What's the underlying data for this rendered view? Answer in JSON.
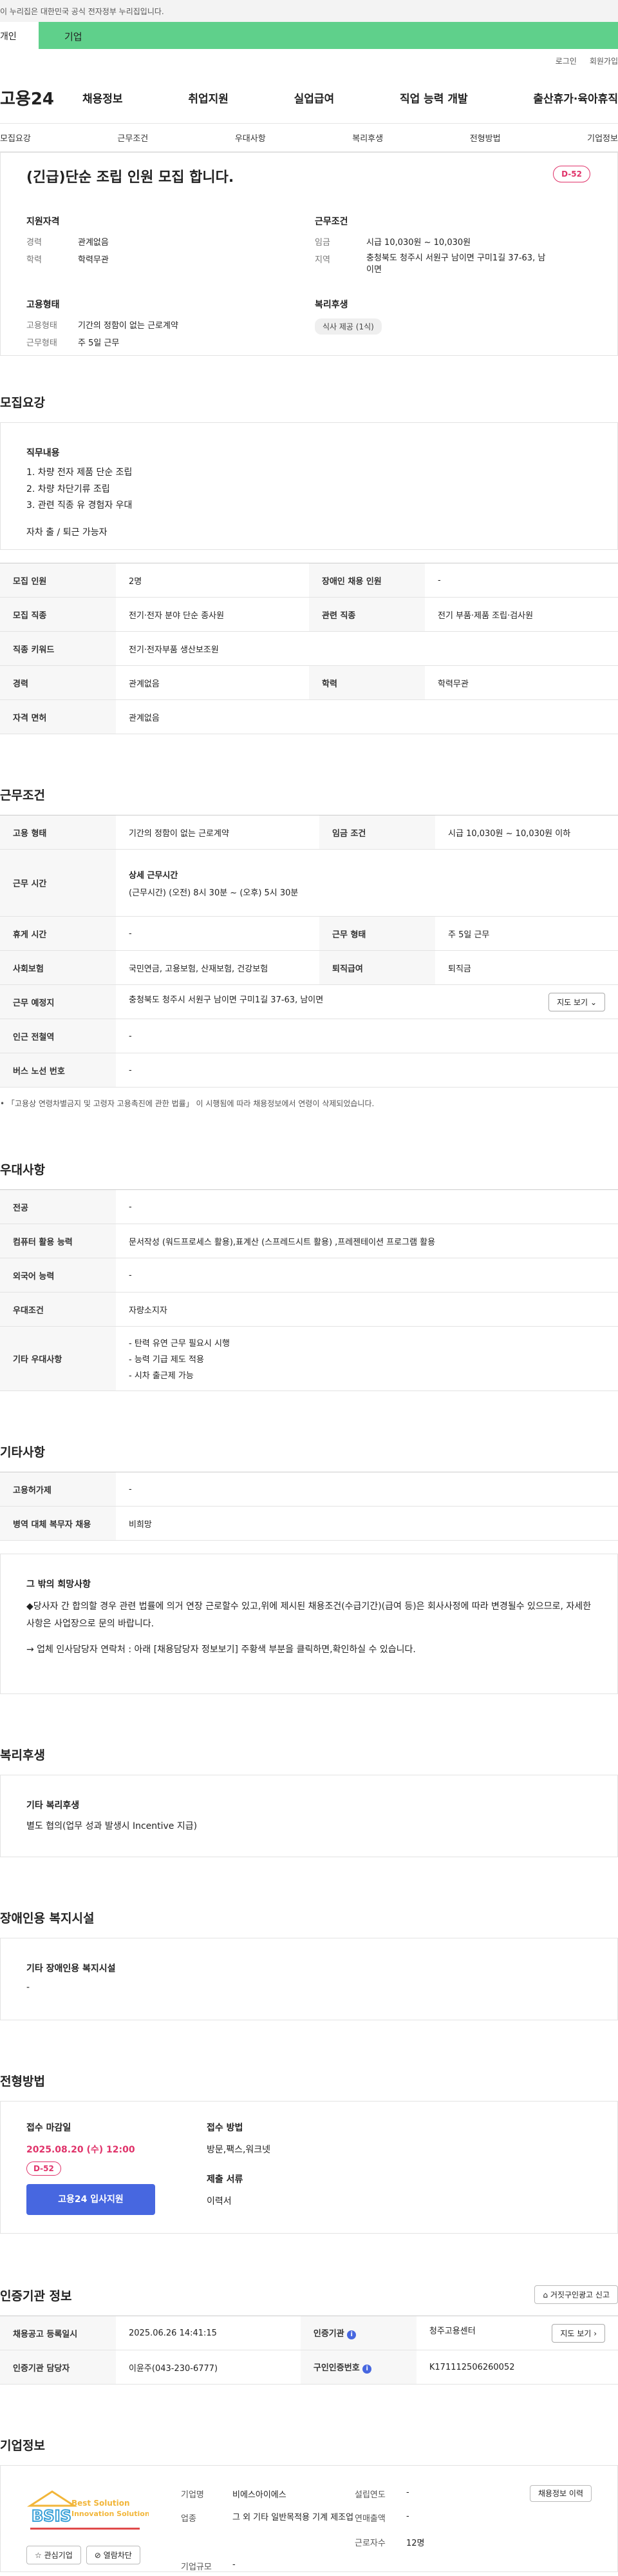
{
  "topbar": {
    "notice": "이 누리집은 대한민국 공식 전자정부 누리집입니다."
  },
  "typebar": {
    "personal": "개인",
    "company": "기업"
  },
  "util": {
    "login": "로그인",
    "join": "회원가입"
  },
  "gnb": {
    "logo": "고용24",
    "menu": [
      "채용정보",
      "취업지원",
      "실업급여",
      "직업 능력 개발",
      "출산휴가·육아휴직"
    ]
  },
  "subnav": [
    "모집요강",
    "근무조건",
    "우대사항",
    "복리후생",
    "전형방법",
    "기업정보"
  ],
  "summary": {
    "title": "(긴급)단순 조립 인원 모집 합니다.",
    "dday": "D-52",
    "qual_h": "지원자격",
    "career_k": "경력",
    "career_v": "관계없음",
    "edu_k": "학력",
    "edu_v": "학력무관",
    "work_h": "근무조건",
    "wage_k": "임금",
    "wage_v": "시급 10,030원 ~ 10,030원",
    "region_k": "지역",
    "region_v": "충청북도 청주시 서원구 남이면 구미1길 37-63, 남이면",
    "emp_h": "고용형태",
    "emptype_k": "고용형태",
    "emptype_v": "기간의 정함이 없는 근로계약",
    "workform_k": "근무형태",
    "workform_v": "주 5일 근무",
    "welfare_h": "복리후생",
    "welfare_tag": "식사 제공 (1식)"
  },
  "recruit": {
    "title": "모집요강",
    "job_h": "직무내용",
    "job_lines": [
      "1. 차량 전자 제품 단순 조립",
      "2. 차량 차단기류 조립",
      "3. 관련 직종 유 경험자 우대",
      "",
      "자차 출 / 퇴근 가능자"
    ],
    "rows": [
      [
        "모집 인원",
        "2명",
        "장애인 채용 인원",
        "-"
      ],
      [
        "모집 직종",
        "전기·전자 분야 단순 종사원",
        "관련 직종",
        "전기 부품·제품 조립·검사원"
      ],
      [
        "직종 키워드",
        "전기·전자부품 생산보조원"
      ],
      [
        "경력",
        "관계없음",
        "학력",
        "학력무관"
      ],
      [
        "자격 면허",
        "관계없음"
      ]
    ]
  },
  "work": {
    "title": "근무조건",
    "r1": [
      "고용 형태",
      "기간의 정함이 없는 근로계약",
      "임금 조건",
      "시급 10,030원 ~ 10,030원 이하"
    ],
    "time_k": "근무 시간",
    "time_h": "상세 근무시간",
    "time_v": "(근무시간) (오전) 8시 30분 ~ (오후) 5시 30분",
    "r3": [
      "휴게 시간",
      "-",
      "근무 형태",
      "주 5일 근무"
    ],
    "r4": [
      "사회보험",
      "국민연금, 고용보험, 산재보험, 건강보험",
      "퇴직급여",
      "퇴직금"
    ],
    "place_k": "근무 예정지",
    "place_v": "충청북도 청주시 서원구 남이면 구미1길 37-63, 남이면",
    "map_btn": "지도 보기",
    "r6": [
      "인근 전철역",
      "-"
    ],
    "r7": [
      "버스 노선 번호",
      "-"
    ],
    "note": "「고용상 연령차별금지 및 고령자 고용촉진에 관한 법률」 이 시행됨에 따라 채용정보에서 연령이 삭제되었습니다."
  },
  "pref": {
    "title": "우대사항",
    "r1": [
      "전공",
      "-"
    ],
    "r2": [
      "컴퓨터 활용 능력",
      "문서작성 (워드프로세스 활용),표계산 (스프레드시트 활용) ,프레젠테이션 프로그램 활용"
    ],
    "r3": [
      "외국어 능력",
      "-"
    ],
    "r4": [
      "우대조건",
      "자량소지자"
    ],
    "etc_k": "기타 우대사항",
    "etc_lines": [
      "- 탄력 유연 근무 필요시 시행",
      "- 능력 기급 제도 적용",
      "- 시차 출근제 가능"
    ]
  },
  "etc": {
    "title": "기타사항",
    "r1": [
      "고용허가제",
      "-"
    ],
    "r2": [
      "병역 대체 복무자 채용",
      "비희망"
    ],
    "box_h": "그 밖의 희망사항",
    "box_lines": [
      "◆당사자 간 합의할 경우 관련 법률에 의거 연장 근로할수 있고,위에 제시된 채용조건(수급기간)(급여 등)은 회사사정에 따라 변경될수 있으므로, 자세한 사항은 사업장으로 문의 바랍니다.",
      "",
      "→ 업체 인사담당자 연락처 : 아래 [채용담당자 정보보기] 주황색 부분을 클릭하면,확인하실 수 있습니다."
    ]
  },
  "welfare": {
    "title": "복리후생",
    "h": "기타 복리후생",
    "v": "별도 협의(업무 성과 발생시 Incentive 지급)"
  },
  "disabled": {
    "title": "장애인용 복지시설",
    "h": "기타 장애인용 복지시설",
    "v": "-"
  },
  "apply": {
    "title": "전형방법",
    "deadline_h": "접수 마감일",
    "deadline_v": "2025.08.20 (수) 12:00",
    "dday": "D-52",
    "btn": "고용24 입사지원",
    "method_h": "접수 방법",
    "method_v": "방문,팩스,워크넷",
    "docs_h": "제출 서류",
    "docs_v": "이력서"
  },
  "cert": {
    "title": "인증기관 정보",
    "report_btn": "거짓구인광고 신고",
    "r1": [
      "채용공고 등록일시",
      "2025.06.26 14:41:15",
      "인증기관",
      "청주고용센터"
    ],
    "r1_btn": "지도 보기",
    "r2": [
      "인증기관 담당자",
      "이윤주(043-230-6777)",
      "구인인증번호",
      "K171112506260052"
    ]
  },
  "company": {
    "title": "기업정보",
    "logo_text": "BSIS",
    "logo_sub1": "Best Solution",
    "logo_sub2": "Innovation Solution",
    "fav_btn": "관심기업",
    "block_btn": "열람차단",
    "name_k": "기업명",
    "name_v": "비에스아이에스",
    "year_k": "설립연도",
    "year_v": "-",
    "ind_k": "업종",
    "ind_v": "그 외 기타 일반목적용 기계 제조업",
    "sales_k": "연매출액",
    "sales_v": "-",
    "emp_k": "근로자수",
    "emp_v": "12명",
    "size_k": "기업규모",
    "size_v": "-",
    "recruit_btn": "채용정보 이력"
  },
  "colors": {
    "accent": "#4767e0",
    "dday": "#e0336a",
    "typebar": "#5fd08b"
  }
}
